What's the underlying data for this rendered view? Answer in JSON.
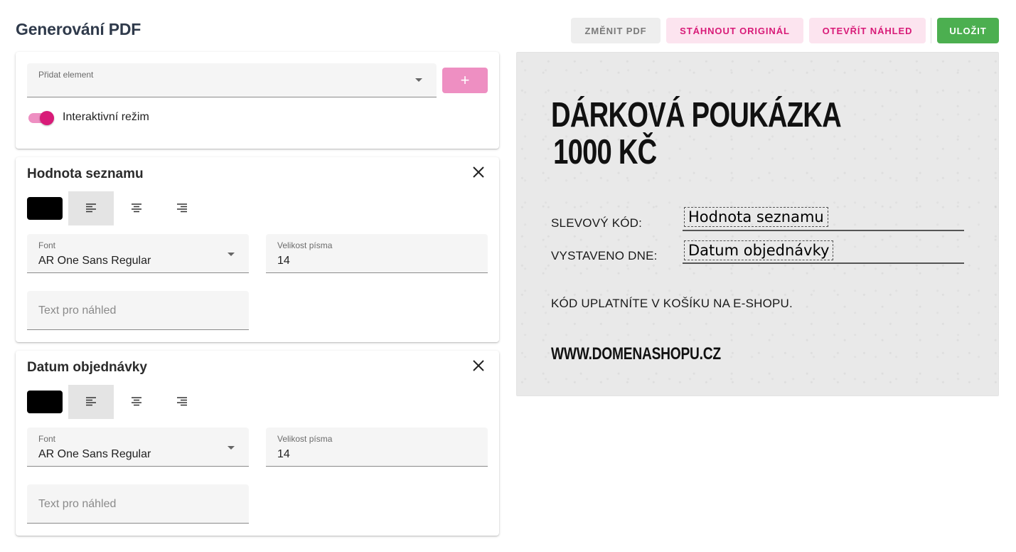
{
  "page": {
    "title": "Generování PDF"
  },
  "toolbar": {
    "change_pdf": "ZMĚNIT PDF",
    "download_original": "STÁHNOUT ORIGINÁL",
    "open_preview": "OTEVŘÍT NÁHLED",
    "save": "ULOŽIT"
  },
  "add_panel": {
    "select_label": "Přidat element",
    "select_value": "",
    "add_button": "+",
    "interactive_mode_label": "Interaktivní režim",
    "interactive_mode_on": true
  },
  "elements": [
    {
      "title": "Hodnota seznamu",
      "color": "#000000",
      "alignment": "left",
      "font_label": "Font",
      "font_value": "AR One Sans Regular",
      "size_label": "Velikost písma",
      "size_value": "14",
      "preview_text_placeholder": "Text pro náhled"
    },
    {
      "title": "Datum objednávky",
      "color": "#000000",
      "alignment": "left",
      "font_label": "Font",
      "font_value": "AR One Sans Regular",
      "size_label": "Velikost písma",
      "size_value": "14",
      "preview_text_placeholder": "Text pro náhled"
    }
  ],
  "voucher": {
    "title_line1": "DÁRKOVÁ POUKÁZKA",
    "title_line2": "1000 KČ",
    "code_label": "SLEVOVÝ KÓD:",
    "code_value": "Hodnota seznamu",
    "date_label": "VYSTAVENO DNE:",
    "date_value": "Datum objednávky",
    "instructions": "KÓD UPLATNÍTE V KOŠÍKU NA E-SHOPU.",
    "website": "WWW.DOMENASHOPU.CZ"
  },
  "colors": {
    "accent_pink": "#d81b78",
    "pink_light": "#fce4ef",
    "save_green": "#4caf50"
  }
}
